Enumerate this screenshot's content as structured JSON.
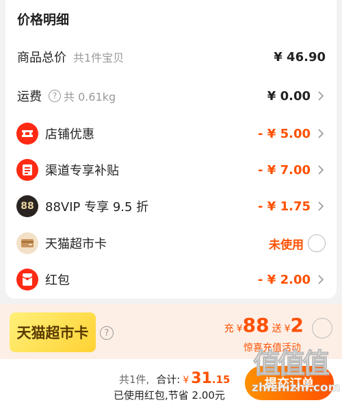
{
  "header": {
    "title": "价格明细"
  },
  "rows": {
    "goods": {
      "label": "商品总价",
      "sub": "共1件宝贝",
      "value": "¥ 46.90"
    },
    "shipping": {
      "label": "运费",
      "sub": "共 0.61kg",
      "value": "¥ 0.00"
    },
    "shop_discount": {
      "label": "店铺优惠",
      "value": "- ¥ 5.00",
      "icon": "ticket-icon"
    },
    "channel_subsidy": {
      "label": "渠道专享补贴",
      "value": "- ¥ 7.00",
      "icon": "subsidy-icon"
    },
    "vip": {
      "label": "88VIP 专享 9.5 折",
      "value": "- ¥ 1.75",
      "icon_text": "88"
    },
    "tmall_card": {
      "label": "天猫超市卡",
      "value": "未使用",
      "icon": "card-icon"
    },
    "red_packet": {
      "label": "红包",
      "value": "- ¥ 2.00",
      "icon": "red-packet-icon"
    }
  },
  "promo": {
    "card_label": "天猫超市卡",
    "charge_word": "充",
    "currency": "¥",
    "charge_amount": "88",
    "gift_word": "送",
    "gift_amount": "2",
    "activity": "惊喜充值活动"
  },
  "footer": {
    "count": "共1件,",
    "total_label": "合计:",
    "currency": "¥",
    "amount_int": "31",
    "amount_dec": ".15",
    "saved": "已使用红包,节省 2.00元",
    "submit": "提交订单"
  },
  "watermark": {
    "glyphs": "值值值",
    "url": "zhizhizhi.com"
  },
  "colors": {
    "accent": "#ff5000",
    "red_icon": "#ff2a14",
    "promo_bg": "#fdefe6"
  }
}
